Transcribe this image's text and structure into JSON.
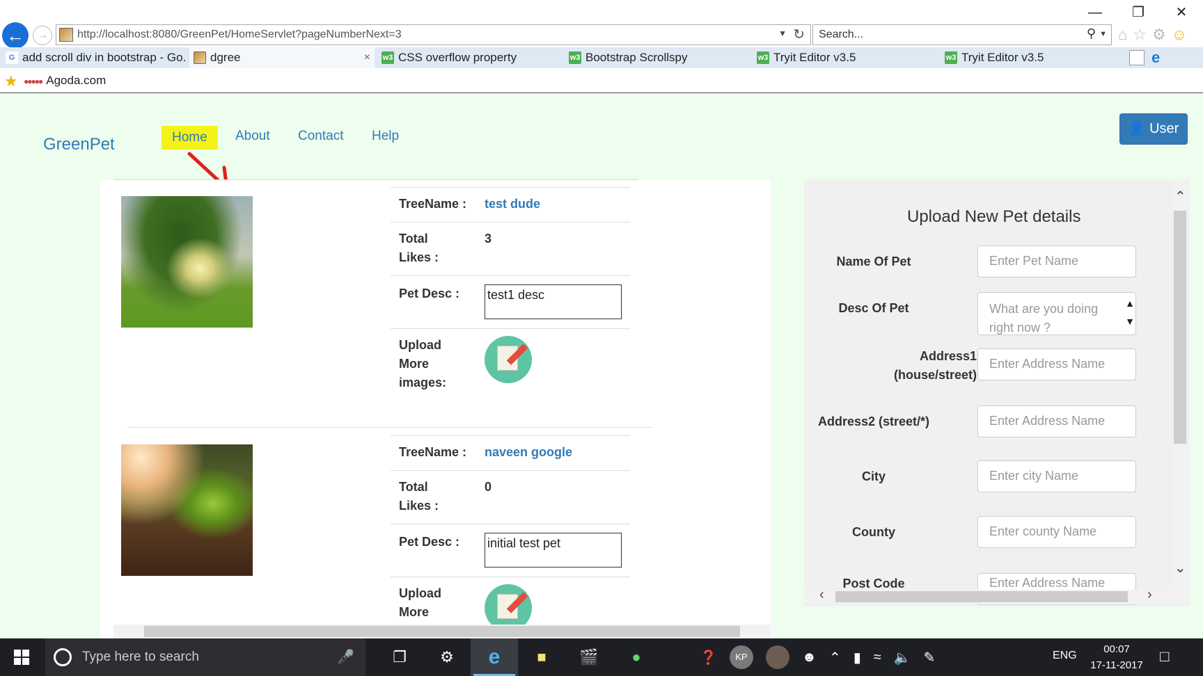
{
  "browser": {
    "url": "http://localhost:8080/GreenPet/HomeServlet?pageNumberNext=3",
    "search_placeholder": "Search...",
    "tabs": [
      {
        "label": "add scroll div in bootstrap - Go...",
        "icon": "google-icon"
      },
      {
        "label": "dgree",
        "icon": "page-icon",
        "active": true
      },
      {
        "label": "CSS overflow property",
        "icon": "w3-icon"
      },
      {
        "label": "Bootstrap Scrollspy",
        "icon": "w3-icon"
      },
      {
        "label": "Tryit Editor v3.5",
        "icon": "w3-icon"
      },
      {
        "label": "Tryit Editor v3.5",
        "icon": "w3-icon"
      }
    ],
    "favorites": [
      {
        "label": "Agoda.com"
      }
    ]
  },
  "nav": {
    "brand": "GreenPet",
    "items": [
      "Home",
      "About",
      "Contact",
      "Help"
    ],
    "active": "Home",
    "user_button": "User"
  },
  "pets": [
    {
      "tree_name_label": "TreeName :",
      "tree_name": "test dude",
      "likes_label": "Total Likes :",
      "likes": "3",
      "desc_label": "Pet Desc :",
      "desc": "test1 desc",
      "upload_label": "Upload More images:"
    },
    {
      "tree_name_label": "TreeName :",
      "tree_name": "naveen google",
      "likes_label": "Total Likes :",
      "likes": "0",
      "desc_label": "Pet Desc :",
      "desc": "initial test pet",
      "upload_label": "Upload More images:"
    }
  ],
  "upload_form": {
    "title": "Upload New Pet details",
    "fields": [
      {
        "label": "Name Of Pet",
        "placeholder": "Enter Pet Name"
      },
      {
        "label": "Desc Of Pet",
        "placeholder": "What are you doing right now ?"
      },
      {
        "label": "Address1 (house/street)",
        "placeholder": "Enter Address Name"
      },
      {
        "label": "Address2 (street/*)",
        "placeholder": "Enter Address Name"
      },
      {
        "label": "City",
        "placeholder": "Enter city Name"
      },
      {
        "label": "County",
        "placeholder": "Enter county Name"
      },
      {
        "label": "Post Code",
        "placeholder": "Enter Address Name"
      }
    ]
  },
  "taskbar": {
    "search_placeholder": "Type here to search",
    "avatar_initials": "KP",
    "language": "ENG",
    "time": "00:07",
    "date": "17-11-2017"
  },
  "colors": {
    "link": "#337ab7",
    "page_bg": "#edfdee",
    "highlight": "#f3f317",
    "annotation_arrow": "#e0201c"
  }
}
